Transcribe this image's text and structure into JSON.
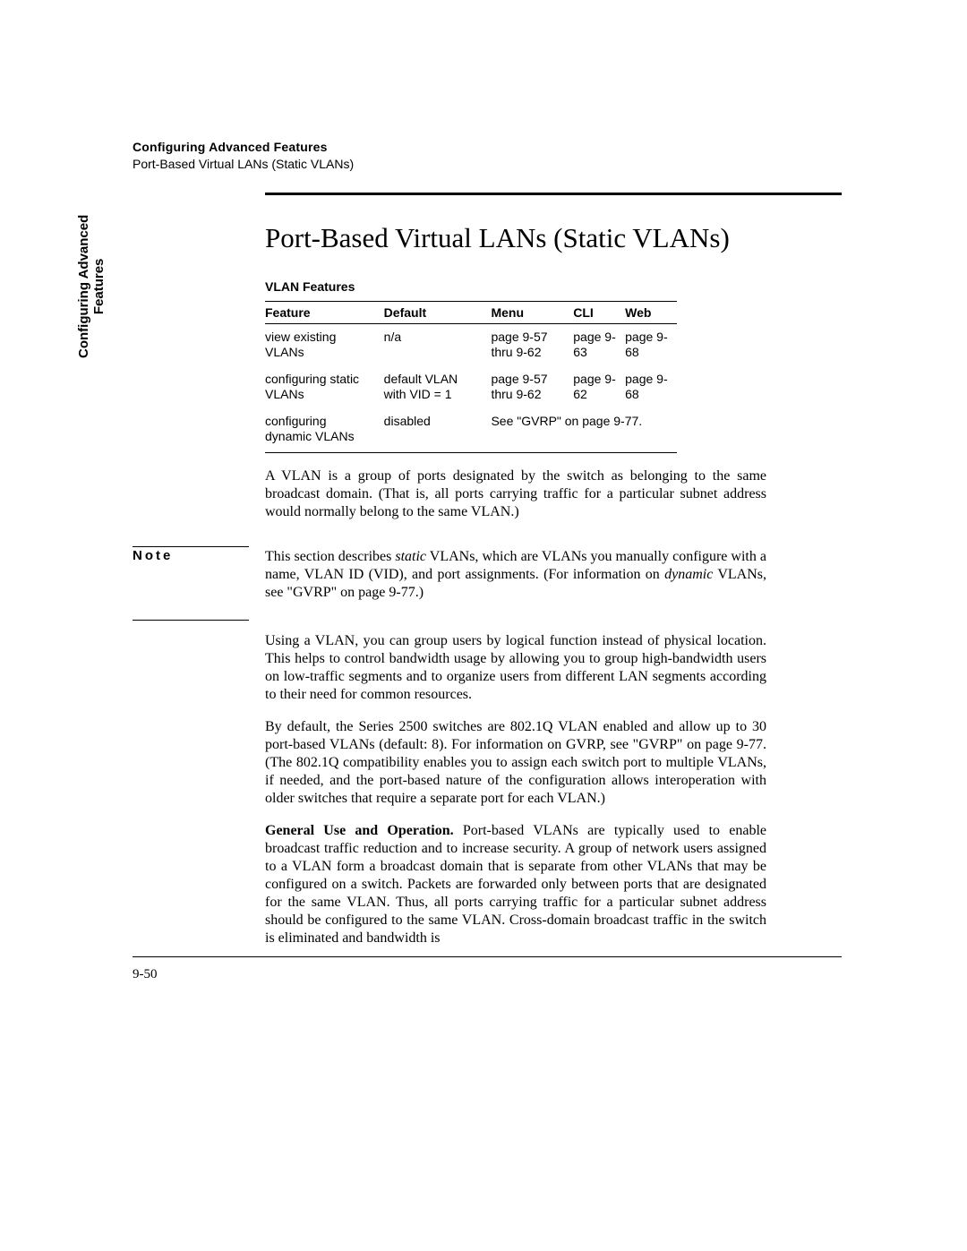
{
  "running_head": {
    "title": "Configuring Advanced Features",
    "subtitle": "Port-Based Virtual LANs (Static VLANs)"
  },
  "side_tab": {
    "line1": "Configuring Advanced",
    "line2": "Features"
  },
  "heading": "Port-Based Virtual LANs (Static VLANs)",
  "table": {
    "caption": "VLAN Features",
    "headers": {
      "feature": "Feature",
      "default": "Default",
      "menu": "Menu",
      "cli": "CLI",
      "web": "Web"
    },
    "rows": [
      {
        "feature": "view existing VLANs",
        "default": "n/a",
        "menu": "page 9-57 thru 9-62",
        "cli": "page 9-63",
        "web": "page 9-68"
      },
      {
        "feature": "configuring static VLANs",
        "default": "default VLAN with VID = 1",
        "menu": "page 9-57 thru 9-62",
        "cli": "page 9-62",
        "web": "page 9-68"
      },
      {
        "feature": "configuring dynamic VLANs",
        "default": "disabled",
        "menu_span": "See \"GVRP\" on page 9-77."
      }
    ]
  },
  "paragraphs": {
    "p1": "A VLAN is a group of ports designated by the switch as belonging to the same broadcast domain. (That is, all ports carrying traffic for a particular subnet address would normally belong to the same VLAN.)",
    "note_label": "Note",
    "note_pre": "This section describes ",
    "note_ital1": "static",
    "note_mid": " VLANs, which are VLANs you manually configure with a name, VLAN ID (VID), and port assignments. (For information on ",
    "note_ital2": "dynamic",
    "note_post": " VLANs, see \"GVRP\" on page 9-77.)",
    "p3": "Using a VLAN, you can group users by logical function instead of physical location. This helps to control bandwidth usage by allowing you to group high-bandwidth users on low-traffic segments and to organize users from different LAN segments according to their need for common resources.",
    "p4": "By default, the Series 2500 switches are 802.1Q VLAN enabled and allow up to 30 port-based VLANs (default: 8). For information on GVRP, see \"GVRP\" on page 9-77. (The 802.1Q compatibility enables you to assign each switch port to multiple VLANs, if needed, and the port-based nature of the configuration allows interoperation with older switches that require a separate port for each VLAN.)",
    "p5_runin": "General Use and Operation.",
    "p5_rest": "  Port-based VLANs are typically used to enable broadcast traffic reduction and to increase security. A group of network users assigned to a VLAN form a broadcast domain that is separate from other VLANs that may be configured on a switch. Packets are forwarded only between ports that are designated for the same VLAN. Thus, all ports carrying traffic for a particular subnet address should be configured to the same VLAN. Cross-domain broadcast traffic in the switch is eliminated and bandwidth is"
  },
  "page_number": "9-50"
}
